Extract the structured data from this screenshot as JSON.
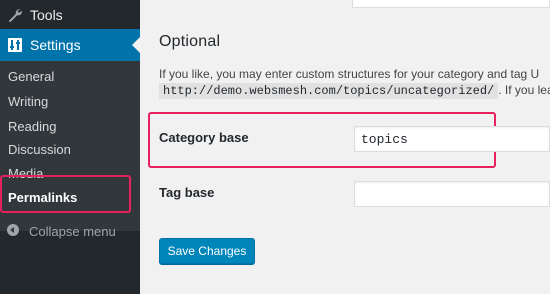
{
  "sidebar": {
    "tools_label": "Tools",
    "settings_label": "Settings",
    "submenu": [
      {
        "label": "General"
      },
      {
        "label": "Writing"
      },
      {
        "label": "Reading"
      },
      {
        "label": "Discussion"
      },
      {
        "label": "Media"
      },
      {
        "label": "Permalinks"
      }
    ],
    "collapse_label": "Collapse menu"
  },
  "main": {
    "section_title": "Optional",
    "description_line1": "If you like, you may enter custom structures for your category and tag U",
    "description_code": "http://demo.websmesh.com/topics/uncategorized/",
    "description_line2_tail": ". If you leav",
    "category_base_label": "Category base",
    "category_base_value": "topics",
    "tag_base_label": "Tag base",
    "tag_base_value": "",
    "save_button_label": "Save Changes"
  },
  "colors": {
    "accent": "#0073aa",
    "highlight": "#e5215e",
    "sidebar_bg": "#23282d"
  }
}
